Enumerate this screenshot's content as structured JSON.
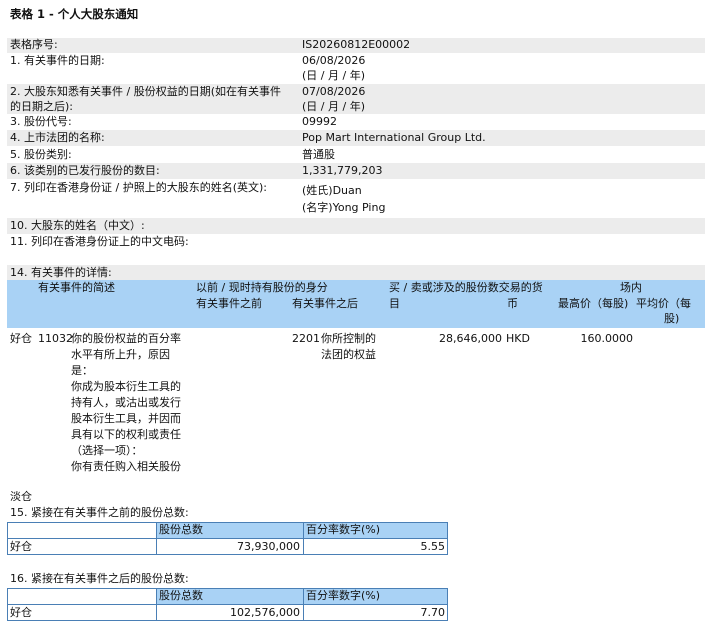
{
  "title": "表格 1 - 个人大股东通知",
  "info_rows": [
    {
      "label": "表格序号:",
      "value": "IS20260812E00002",
      "sub": ""
    },
    {
      "label": "1. 有关事件的日期:",
      "value": "06/08/2026",
      "sub": "(日 / 月 / 年)"
    },
    {
      "label": "2. 大股东知悉有关事件 / 股份权益的日期(如在有关事件",
      "label2": "的日期之后):",
      "value": "07/08/2026",
      "sub": "(日 / 月 / 年)"
    },
    {
      "label": "3. 股份代号:",
      "value": "09992",
      "sub": ""
    },
    {
      "label": "4. 上市法团的名称:",
      "value": "Pop Mart International Group Ltd.",
      "sub": ""
    },
    {
      "label": "5. 股份类别:",
      "value": "普通股",
      "sub": ""
    },
    {
      "label": "6. 该类别的已发行股份的数目:",
      "value": "1,331,779,203",
      "sub": ""
    },
    {
      "label": "7. 列印在香港身份证 / 护照上的大股东的姓名(英文):",
      "value": "(姓氏)Duan",
      "sub": "(名字)Yong Ping"
    }
  ],
  "q10": "10. 大股东的姓名（中文）:",
  "q11": "11. 列印在香港身份证上的中文电码:",
  "q14": "14. 有关事件的详情:",
  "table_headers": {
    "event_desc": "有关事件的简述",
    "capacity": "以前 / 现时持有股份的身分",
    "before": "有关事件之前",
    "after": "有关事件之后",
    "shares_1": "买 / 卖或涉及的股份数交易的货",
    "shares_2": "目",
    "currency": "币",
    "market": "场内",
    "highest": "最高价（每股)",
    "average_1": "平均价（每",
    "average_2": "股)"
  },
  "event_row": {
    "position": "好仓",
    "code": "11032",
    "description": "你的股份权益的百分率\n水平有所上升，原因\n是：\n你成为股本衍生工具的\n持有人，或沽出或发行\n股本衍生工具，并因而\n具有以下的权利或责任\n（选择一项）：\n你有责任购入相关股份",
    "capacity_code": "2201",
    "capacity_desc": "你所控制的\n法团的权益",
    "shares": "28,646,000",
    "currency": "HKD",
    "highest_price": "160.0000",
    "average_price": ""
  },
  "short_label": "淡仓",
  "q15": {
    "label": "15. 紧接在有关事件之前的股份总数:",
    "col_shares": "股份总数",
    "col_percent": "百分率数字(%)",
    "row_label": "好仓",
    "shares": "73,930,000",
    "percent": "5.55"
  },
  "q16": {
    "label": "16. 紧接在有关事件之后的股份总数:",
    "col_shares": "股份总数",
    "col_percent": "百分率数字(%)",
    "row_label": "好仓",
    "shares": "102,576,000",
    "percent": "7.70"
  },
  "colors": {
    "shade": "#ececec",
    "header_blue": "#a9d2f5",
    "border": "#4a7fb5"
  }
}
